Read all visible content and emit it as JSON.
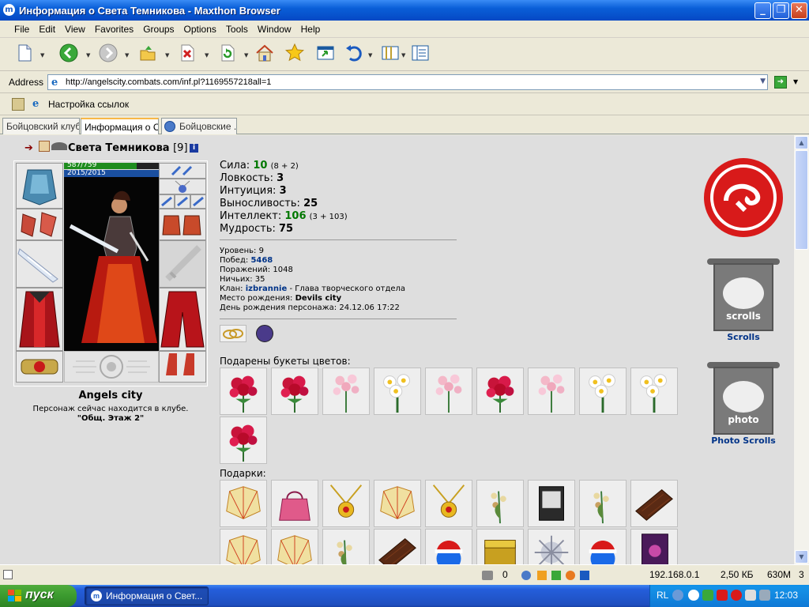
{
  "window": {
    "title": "Информация о Света Темникова - Maxthon Browser",
    "app_icon": "m"
  },
  "menu": [
    "File",
    "Edit",
    "View",
    "Favorites",
    "Groups",
    "Options",
    "Tools",
    "Window",
    "Help"
  ],
  "address": {
    "label": "Address",
    "url": "http://angelscity.combats.com/inf.pl?1169557218all=1"
  },
  "links": {
    "item": "Настройка ссылок"
  },
  "tabs": [
    {
      "label": "Бойцовский клуб",
      "active": false
    },
    {
      "label": "Информация о С...",
      "active": true
    },
    {
      "label": "Бойцовские ...",
      "active": false
    }
  ],
  "character": {
    "name": "Света Темникова",
    "level": "[9]",
    "hp": "587/759",
    "mana": "2015/2015",
    "city": "Angels city",
    "location_text": "Персонаж сейчас находится в клубе.",
    "location_room": "\"Общ. Этаж 2\""
  },
  "stats": [
    {
      "label": "Сила:",
      "value": "10",
      "extra": "(8 + 2)",
      "green": true
    },
    {
      "label": "Ловкость:",
      "value": "3",
      "extra": "",
      "green": false
    },
    {
      "label": "Интуиция:",
      "value": "3",
      "extra": "",
      "green": false
    },
    {
      "label": "Выносливость:",
      "value": "25",
      "extra": "",
      "green": false
    },
    {
      "label": "Интеллект:",
      "value": "106",
      "extra": "(3 + 103)",
      "green": true
    },
    {
      "label": "Мудрость:",
      "value": "75",
      "extra": "",
      "green": false
    }
  ],
  "info": {
    "level_label": "Уровень:",
    "level_value": "9",
    "wins_label": "Побед:",
    "wins_value": "5468",
    "losses_label": "Поражений:",
    "losses_value": "1048",
    "draws_label": "Ничьих:",
    "draws_value": "35",
    "clan_label": "Клан:",
    "clan_value": "izbrannie",
    "clan_role": "- Глава творческого отдела",
    "birthplace_label": "Место рождения:",
    "birthplace_value": "Devils city",
    "birthday_label": "День рождения персонажа:",
    "birthday_value": "24.12.06 17:22"
  },
  "flowers_title": "Подарены букеты цветов:",
  "flowers": [
    "red-roses",
    "red-roses",
    "pink-lilies",
    "daisies",
    "pink-lilies",
    "red-roses",
    "pink-lilies",
    "daisies",
    "daisies",
    "red-roses"
  ],
  "gifts_title": "Подарки:",
  "gifts_row1": [
    "fan",
    "handbag",
    "gold-pendant",
    "fan",
    "gold-pendant",
    "lily-of-valley",
    "book",
    "lily-of-valley",
    "chocolate"
  ],
  "gifts_row2": [
    "fan",
    "fan",
    "lily-of-valley",
    "chocolate",
    "santa-smiley",
    "gold-chest",
    "snowflake",
    "santa-smiley",
    "purple-card"
  ],
  "banners": {
    "scrolls": "Scrolls",
    "scrolls_inner": "scrolls",
    "photo": "Photo Scrolls",
    "photo_inner": "photo"
  },
  "status": {
    "count": "0",
    "ip": "192.168.0.1",
    "size": "2,50 КБ",
    "memory": "630M",
    "number": "3"
  },
  "taskbar": {
    "start": "пуск",
    "task": "Информация о Свет...",
    "lang": "RL",
    "clock": "12:03"
  },
  "colors": {
    "titlebar": "#0a5fd8",
    "start_green": "#3b9a2f",
    "content_bg": "#dedede",
    "stat_green": "#007800",
    "link_blue": "#003388",
    "hp_green": "#1e8c1e",
    "mana_blue": "#1a4fa0"
  }
}
